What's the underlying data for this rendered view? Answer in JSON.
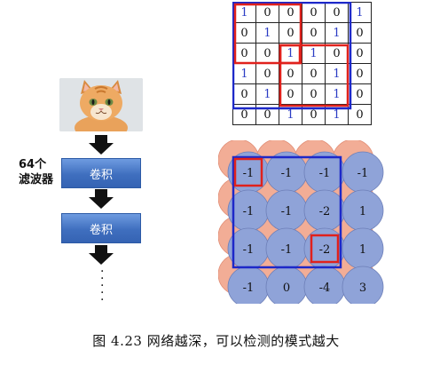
{
  "left": {
    "filter_count_label_line1": "64个",
    "filter_count_label_line2": "滤波器",
    "conv_label_1": "卷积",
    "conv_label_2": "卷积",
    "continuation_glyph": "⋮"
  },
  "top_grid": {
    "rows": [
      [
        "1",
        "0",
        "0",
        "0",
        "0",
        "1"
      ],
      [
        "0",
        "1",
        "0",
        "0",
        "1",
        "0"
      ],
      [
        "0",
        "0",
        "1",
        "1",
        "0",
        "0"
      ],
      [
        "1",
        "0",
        "0",
        "0",
        "1",
        "0"
      ],
      [
        "0",
        "1",
        "0",
        "0",
        "1",
        "0"
      ],
      [
        "0",
        "0",
        "1",
        "0",
        "1",
        "0"
      ]
    ]
  },
  "bottom_grid": {
    "values": [
      [
        "-1",
        "-1",
        "-1",
        "-1"
      ],
      [
        "-1",
        "-1",
        "-2",
        "1"
      ],
      [
        "-1",
        "-1",
        "-2",
        "1"
      ],
      [
        "-1",
        "0",
        "-4",
        "3"
      ]
    ]
  },
  "colors": {
    "red": "#e0211c",
    "blue": "#1d28c9",
    "circle_blue": "#8fa3d8",
    "circle_peach": "#f2ad96"
  },
  "caption": "图 4.23    网络越深，可以检测的模式越大"
}
